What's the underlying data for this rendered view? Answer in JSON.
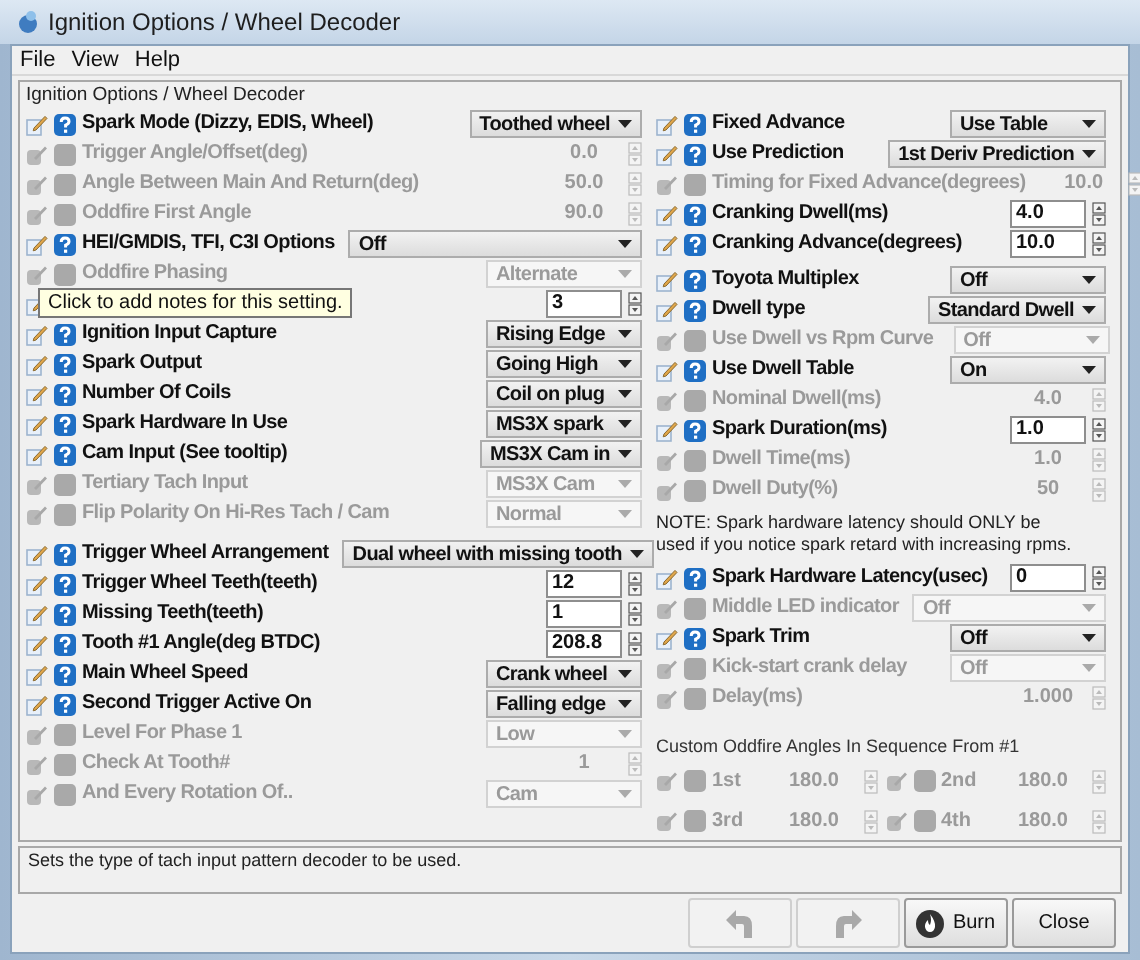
{
  "window": {
    "title": "Ignition Options / Wheel Decoder"
  },
  "menu": [
    {
      "label": "File"
    },
    {
      "label": "View"
    },
    {
      "label": "Help"
    }
  ],
  "panel_title": "Ignition Options / Wheel Decoder",
  "left": [
    {
      "kind": "rows",
      "rows": [
        {
          "label": "Spark Mode (Dizzy, EDIS, Wheel)",
          "kind": "select",
          "value": "Toothed wheel",
          "enabled": true
        },
        {
          "label": "Trigger Angle/Offset(deg)",
          "kind": "spinner",
          "value": "0.0",
          "enabled": false
        },
        {
          "label": "Angle Between Main And Return(deg)",
          "kind": "spinner",
          "value": "50.0",
          "enabled": false
        },
        {
          "label": "Oddfire First Angle",
          "kind": "spinner",
          "value": "90.0",
          "enabled": false
        },
        {
          "label": "HEI/GMDIS, TFI, C3I Options",
          "kind": "wideselect",
          "value": "Off",
          "enabled": true
        },
        {
          "label": "Oddfire Phasing",
          "kind": "select",
          "value": "Alternate",
          "enabled": false
        },
        {
          "kind": "spinner",
          "value": "3",
          "enabled": true,
          "tooltip": "Click to add notes for this setting."
        },
        {
          "label": "Ignition Input Capture",
          "kind": "select",
          "value": "Rising Edge",
          "enabled": true
        },
        {
          "label": "Spark Output",
          "kind": "select",
          "value": "Going High",
          "enabled": true
        },
        {
          "label": "Number Of Coils",
          "kind": "select",
          "value": "Coil on plug",
          "enabled": true
        },
        {
          "label": "Spark Hardware In Use",
          "kind": "select",
          "value": "MS3X spark",
          "enabled": true
        },
        {
          "label": "Cam Input (See tooltip)",
          "kind": "select",
          "value": "MS3X Cam in",
          "enabled": true
        },
        {
          "label": "Tertiary Tach Input",
          "kind": "select",
          "value": "MS3X Cam",
          "enabled": false
        },
        {
          "label": "Flip Polarity On Hi-Res Tach / Cam",
          "kind": "select",
          "value": "Normal",
          "enabled": false
        }
      ]
    },
    {
      "kind": "rows",
      "rows": [
        {
          "label": "Trigger Wheel Arrangement",
          "kind": "wideselect",
          "value": "Dual wheel with missing tooth",
          "enabled": true
        },
        {
          "label": "Trigger Wheel Teeth(teeth)",
          "kind": "spinner",
          "value": "12",
          "enabled": true
        },
        {
          "label": "Missing Teeth(teeth)",
          "kind": "spinner",
          "value": "1",
          "enabled": true
        },
        {
          "label": "Tooth #1 Angle(deg BTDC)",
          "kind": "spinner",
          "value": "208.8",
          "enabled": true
        },
        {
          "label": "Main Wheel Speed",
          "kind": "select",
          "value": "Crank wheel",
          "enabled": true
        },
        {
          "label": "Second Trigger Active On",
          "kind": "select",
          "value": "Falling edge",
          "enabled": true
        },
        {
          "label": "Level For Phase 1",
          "kind": "select",
          "value": "Low",
          "enabled": false
        },
        {
          "label": "Check At Tooth#",
          "kind": "spinner",
          "value": "1",
          "enabled": false
        },
        {
          "label": "And Every Rotation Of..",
          "kind": "select",
          "value": "Cam",
          "enabled": false
        }
      ]
    }
  ],
  "right": [
    {
      "kind": "rows",
      "rows": [
        {
          "label": "Fixed Advance",
          "kind": "select",
          "value": "Use Table",
          "enabled": true
        },
        {
          "label": "Use Prediction",
          "kind": "select",
          "value": "1st Deriv Prediction",
          "enabled": true
        },
        {
          "label": "Timing for Fixed Advance(degrees)",
          "kind": "spinner",
          "value": "10.0",
          "enabled": false
        },
        {
          "label": "Cranking Dwell(ms)",
          "kind": "spinner",
          "value": "4.0",
          "enabled": true
        },
        {
          "label": "Cranking Advance(degrees)",
          "kind": "spinner",
          "value": "10.0",
          "enabled": true
        }
      ]
    },
    {
      "kind": "rows",
      "rows": [
        {
          "label": "Toyota Multiplex",
          "kind": "select",
          "value": "Off",
          "enabled": true
        },
        {
          "label": "Dwell type",
          "kind": "select",
          "value": "Standard Dwell",
          "enabled": true
        },
        {
          "label": "Use Dwell vs Rpm Curve",
          "kind": "select",
          "value": "Off",
          "enabled": false
        },
        {
          "label": "Use Dwell Table",
          "kind": "select",
          "value": "On",
          "enabled": true
        },
        {
          "label": "Nominal Dwell(ms)",
          "kind": "spinner",
          "value": "4.0",
          "enabled": false
        },
        {
          "label": "Spark Duration(ms)",
          "kind": "spinner",
          "value": "1.0",
          "enabled": true
        },
        {
          "label": "Dwell Time(ms)",
          "kind": "spinner",
          "value": "1.0",
          "enabled": false
        },
        {
          "label": "Dwell Duty(%)",
          "kind": "spinner",
          "value": "50",
          "enabled": false
        }
      ]
    },
    {
      "kind": "note",
      "text": "NOTE: Spark hardware latency should ONLY be used if you notice spark retard with increasing rpms."
    },
    {
      "kind": "rows",
      "rows": [
        {
          "label": "Spark Hardware Latency(usec)",
          "kind": "spinner",
          "value": "0",
          "enabled": true
        },
        {
          "label": "Middle LED indicator",
          "kind": "wideselect",
          "value": "Off",
          "enabled": false
        },
        {
          "label": "Spark Trim",
          "kind": "select",
          "value": "Off",
          "enabled": true
        },
        {
          "label": "Kick-start crank delay",
          "kind": "select",
          "value": "Off",
          "enabled": false
        },
        {
          "label": "Delay(ms)",
          "kind": "spinner",
          "value": "1.000",
          "enabled": false
        }
      ]
    },
    {
      "kind": "heading",
      "text": "Custom Oddfire Angles In Sequence From #1"
    },
    {
      "kind": "grid",
      "items": [
        {
          "label": "1st",
          "value": "180.0",
          "enabled": false
        },
        {
          "label": "2nd",
          "value": "180.0",
          "enabled": false
        },
        {
          "label": "3rd",
          "value": "180.0",
          "enabled": false
        },
        {
          "label": "4th",
          "value": "180.0",
          "enabled": false
        }
      ]
    }
  ],
  "status": "Sets the type of tach input pattern decoder to be used.",
  "buttons": [
    {
      "kind": "undo",
      "enabled": false
    },
    {
      "kind": "redo",
      "enabled": false
    },
    {
      "kind": "burn",
      "label": "Burn",
      "enabled": true
    },
    {
      "kind": "close",
      "label": "Close",
      "enabled": true
    }
  ]
}
